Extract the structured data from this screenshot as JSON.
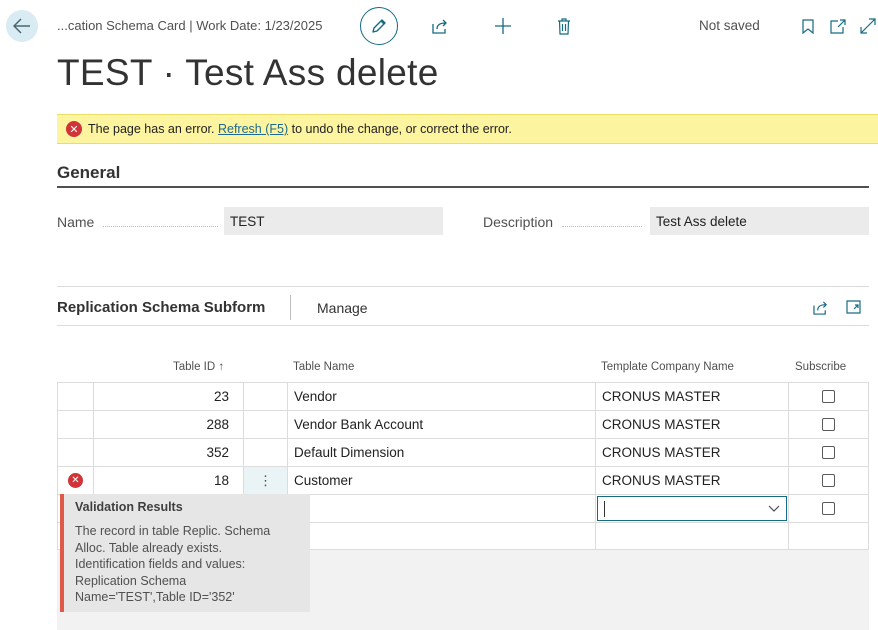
{
  "header": {
    "breadcrumb": "...cation Schema Card | Work Date: 1/23/2025",
    "status": "Not saved",
    "icons": [
      "back-arrow-icon",
      "edit-pencil-icon",
      "share-icon",
      "add-icon",
      "delete-icon",
      "bookmark-icon",
      "open-new-window-icon",
      "expand-icon"
    ]
  },
  "page": {
    "title": "TEST · Test Ass delete"
  },
  "error_banner": {
    "text_before": "The page has an error.",
    "link": "Refresh (F5)",
    "text_after": "to undo the change, or correct the error.",
    "color": "#fdf4a0"
  },
  "general": {
    "title": "General",
    "name_label": "Name",
    "name_value": "TEST",
    "description_label": "Description",
    "description_value": "Test Ass delete"
  },
  "subform": {
    "title": "Replication Schema Subform",
    "manage": "Manage",
    "columns": {
      "table_id": "Table ID ↑",
      "table_name": "Table Name",
      "template_company": "Template Company Name",
      "subscribe": "Subscribe"
    },
    "rows": [
      {
        "table_id": "23",
        "table_name": "Vendor",
        "template_company": "CRONUS MASTER",
        "subscribe": false
      },
      {
        "table_id": "288",
        "table_name": "Vendor Bank Account",
        "template_company": "CRONUS MASTER",
        "subscribe": false
      },
      {
        "table_id": "352",
        "table_name": "Default Dimension",
        "template_company": "CRONUS MASTER",
        "subscribe": false
      },
      {
        "table_id": "18",
        "table_name": "Customer",
        "template_company": "CRONUS MASTER",
        "subscribe": false,
        "has_error": true
      }
    ],
    "row_menu_glyph": "⋮"
  },
  "validation": {
    "title": "Validation Results",
    "message": "The record in table Replic. Schema\nAlloc. Table already exists.\nIdentification fields and values:\nReplication Schema\nName='TEST',Table ID='352'",
    "accent": "#e05a4a"
  },
  "colors": {
    "accent": "#146b83",
    "error": "#d13438"
  }
}
